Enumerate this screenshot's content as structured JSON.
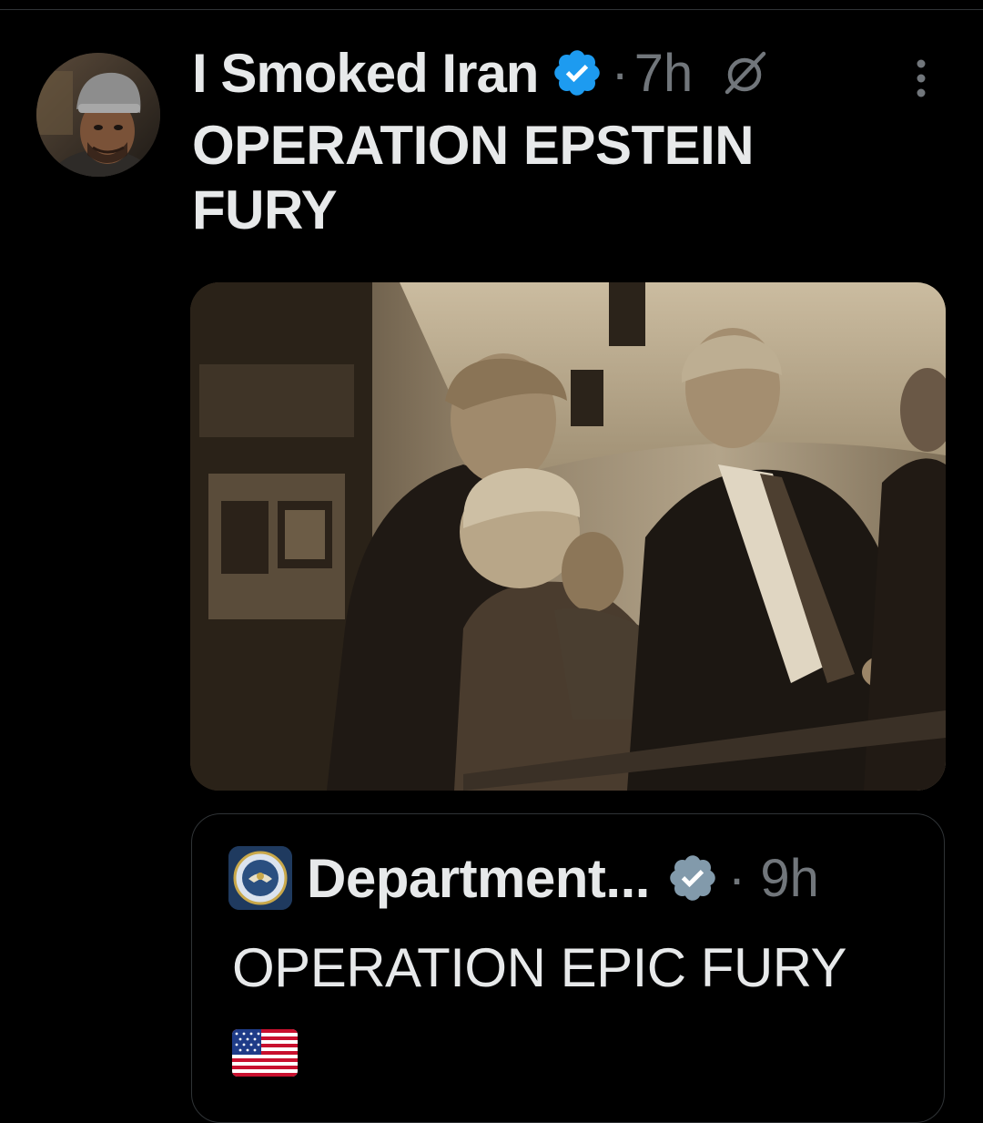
{
  "post": {
    "display_name": "I Smoked Iran",
    "timestamp": "7h",
    "separator": "·",
    "text_line1": "OPERATION EPSTEIN",
    "text_line2": "FURY",
    "icons": {
      "verified": "verified-badge-icon",
      "grok": "grok-icon",
      "more": "more-options-icon"
    }
  },
  "quoted_post": {
    "display_name": "Department...",
    "timestamp": "9h",
    "separator": "·",
    "text": "OPERATION EPIC FURY",
    "emoji": "us-flag-emoji"
  },
  "colors": {
    "background": "#000000",
    "primary_text": "#e7e9ea",
    "secondary_text": "#71767b",
    "verified_blue": "#1d9bf0",
    "verified_gray": "#829aab",
    "border": "#2f3336"
  }
}
